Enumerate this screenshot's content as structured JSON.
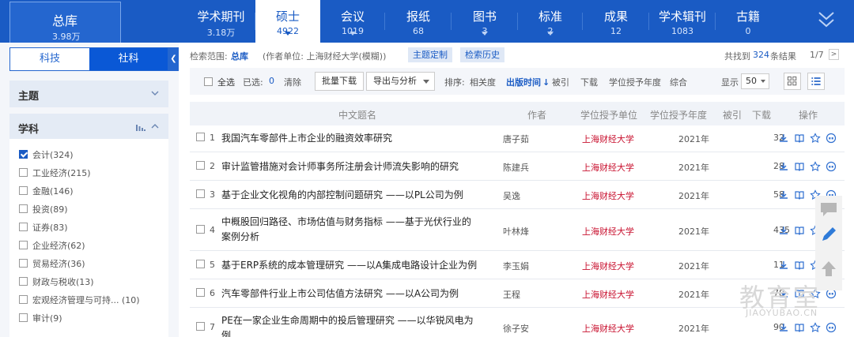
{
  "topnav": {
    "total": {
      "label": "总库",
      "count": "3.98万"
    },
    "tabs": [
      {
        "label": "学术期刊",
        "count": "3.18万"
      },
      {
        "label": "硕士",
        "count": "4922"
      },
      {
        "label": "会议",
        "count": "1019"
      },
      {
        "label": "报纸",
        "count": "68"
      },
      {
        "label": "图书",
        "count": "3"
      },
      {
        "label": "标准",
        "count": "2"
      },
      {
        "label": "成果",
        "count": "12"
      },
      {
        "label": "学术辑刊",
        "count": "1083"
      },
      {
        "label": "古籍",
        "count": "0"
      }
    ],
    "active_index": 1
  },
  "left": {
    "segments": [
      "科技",
      "社科"
    ],
    "facet_topic": "主题",
    "facet_subject": "学科",
    "subjects": [
      {
        "label": "会计(324)",
        "checked": true
      },
      {
        "label": "工业经济(215)",
        "checked": false
      },
      {
        "label": "金融(146)",
        "checked": false
      },
      {
        "label": "投资(89)",
        "checked": false
      },
      {
        "label": "证券(83)",
        "checked": false
      },
      {
        "label": "企业经济(62)",
        "checked": false
      },
      {
        "label": "贸易经济(36)",
        "checked": false
      },
      {
        "label": "财政与税收(13)",
        "checked": false
      },
      {
        "label": "宏观经济管理与可持... (10)",
        "checked": false
      },
      {
        "label": "审计(9)",
        "checked": false
      }
    ]
  },
  "search": {
    "scope_label": "检索范围:",
    "scope_value": "总库",
    "condition": "(作者单位: 上海财经大学(模糊))",
    "btn_topic": "主题定制",
    "btn_history": "检索历史",
    "found_prefix": "共找到",
    "found_count": "324",
    "found_suffix": "条结果",
    "page": "1/7",
    "next": ">"
  },
  "toolbar": {
    "select_all": "全选",
    "selected_label": "已选:",
    "selected_count": "0",
    "clear": "清除",
    "batch_download": "批量下载",
    "export": "导出与分析",
    "sort_label": "排序:",
    "sort_relevance": "相关度",
    "sort_date": "出版时间",
    "sort_cite": "被引",
    "sort_download": "下载",
    "sort_year": "学位授予年度",
    "sort_overall": "综合",
    "show_label": "显示",
    "show_value": "50"
  },
  "table": {
    "headers": [
      "中文题名",
      "作者",
      "学位授予单位",
      "学位授予年度",
      "被引",
      "下载",
      "操作"
    ],
    "rows": [
      {
        "n": "1",
        "title": "我国汽车零部件上市企业的融资效率研究",
        "title2": "",
        "author": "唐子茹",
        "unit": "上海财经大学",
        "year": "2021年",
        "cite": "",
        "dl": "32"
      },
      {
        "n": "2",
        "title": "审计监管措施对会计师事务所注册会计师流失影响的研究",
        "title2": "",
        "author": "陈建兵",
        "unit": "上海财经大学",
        "year": "2021年",
        "cite": "",
        "dl": "28"
      },
      {
        "n": "3",
        "title": "基于企业文化视角的内部控制问题研究 ——以PL公司为例",
        "title2": "",
        "author": "吴逸",
        "unit": "上海财经大学",
        "year": "2021年",
        "cite": "",
        "dl": "58"
      },
      {
        "n": "4",
        "title": "中概股回归路径、市场估值与财务指标 ——基于光伏行业的",
        "title2": "案例分析",
        "author": "叶林烽",
        "unit": "上海财经大学",
        "year": "2021年",
        "cite": "",
        "dl": "435"
      },
      {
        "n": "5",
        "title": "基于ERP系统的成本管理研究 ——以A集成电路设计企业为例",
        "title2": "",
        "author": "李玉娟",
        "unit": "上海财经大学",
        "year": "2021年",
        "cite": "",
        "dl": "11"
      },
      {
        "n": "6",
        "title": "汽车零部件行业上市公司估值方法研究 ——以A公司为例",
        "title2": "",
        "author": "王程",
        "unit": "上海财经大学",
        "year": "2021年",
        "cite": "",
        "dl": "78"
      },
      {
        "n": "7",
        "title": "PE在一家企业生命周期中的投后管理研究 ——以华锐风电为",
        "title2": "例",
        "author": "徐子安",
        "unit": "上海财经大学",
        "year": "2021年",
        "cite": "",
        "dl": "90"
      }
    ]
  },
  "watermark": {
    "line1": "教育室",
    "line2": "JIAOYUBAO.CN"
  },
  "colors": {
    "brand": "#1a5bc4",
    "unit_red": "#c8102e",
    "bg": "#f4f6fa"
  }
}
